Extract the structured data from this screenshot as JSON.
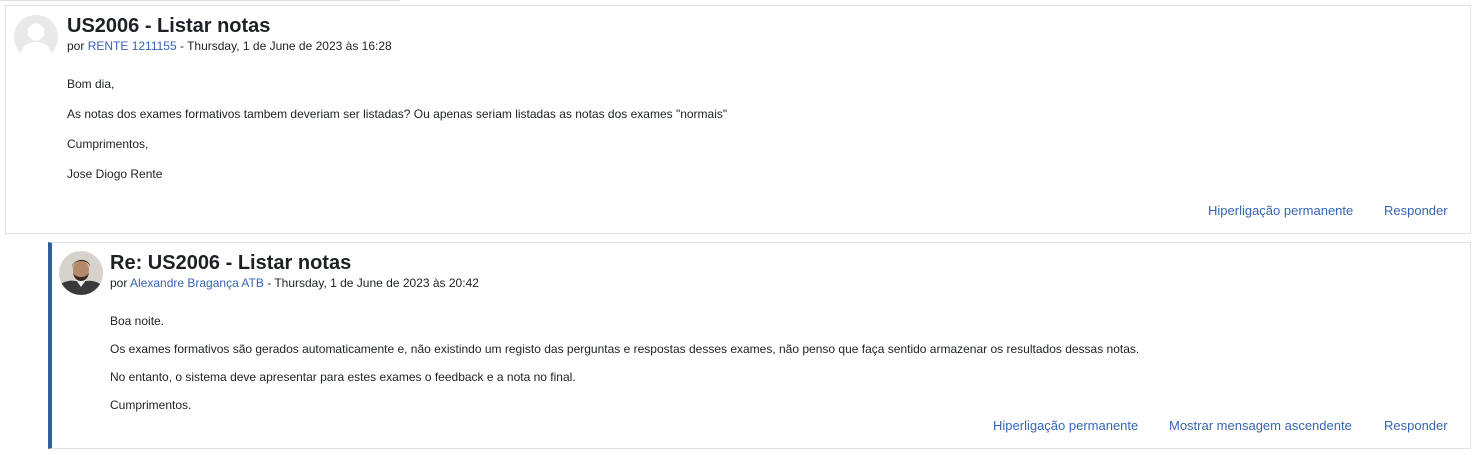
{
  "posts": [
    {
      "subject": "US2006 - Listar notas",
      "by_prefix": "por ",
      "author": "RENTE 1211155",
      "date_text": " - Thursday, 1 de June de 2023 às 16:28",
      "paragraphs": [
        "Bom dia,",
        "As notas dos exames formativos tambem deveriam ser listadas? Ou apenas seriam listadas as notas dos exames \"normais\"",
        "Cumprimentos,",
        "Jose Diogo Rente"
      ],
      "actions": {
        "permalink": "Hiperligação permanente",
        "reply": "Responder"
      },
      "avatar_icon": "default-user-avatar-icon"
    },
    {
      "subject": "Re: US2006 - Listar notas",
      "by_prefix": "por ",
      "author": "Alexandre Bragança ATB",
      "date_text": " - Thursday, 1 de June de 2023 às 20:42",
      "paragraphs": [
        "Boa noite.",
        "Os exames formativos são gerados automaticamente e, não existindo um registo das perguntas e respostas desses exames, não penso que faça sentido armazenar os resultados dessas notas.",
        "No entanto, o sistema deve apresentar para estes exames o feedback e a nota no final.",
        "Cumprimentos."
      ],
      "actions": {
        "permalink": "Hiperligação permanente",
        "show_parent": "Mostrar mensagem ascendente",
        "reply": "Responder"
      },
      "avatar_icon": "user-photo-avatar-icon"
    }
  ],
  "colors": {
    "link": "#3565b5",
    "reply_accent": "#2f5f9f",
    "border": "#dee2e6"
  }
}
